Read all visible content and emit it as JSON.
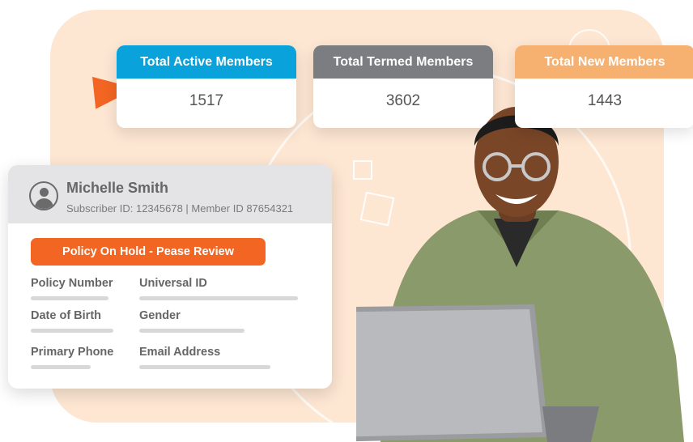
{
  "stats": [
    {
      "label": "Total Active Members",
      "value": "1517",
      "color": "#0aa2db"
    },
    {
      "label": "Total Termed Members",
      "value": "3602",
      "color": "#7b7d80"
    },
    {
      "label": "Total New Members",
      "value": "1443",
      "color": "#f6b06f"
    }
  ],
  "member": {
    "name": "Michelle Smith",
    "ids": "Subscriber ID: 12345678 | Member ID 87654321",
    "alert": "Policy On Hold - Pease Review",
    "fields": {
      "policy_number": "Policy Number",
      "universal_id": "Universal ID",
      "date_of_birth": "Date of Birth",
      "gender": "Gender",
      "primary_phone": "Primary Phone",
      "email_address": "Email Address"
    }
  },
  "colors": {
    "accent": "#f26522",
    "backdrop": "#fde6d2"
  },
  "icons": {
    "avatar": "user-avatar-icon",
    "pointer": "arrow-pointer-icon"
  }
}
